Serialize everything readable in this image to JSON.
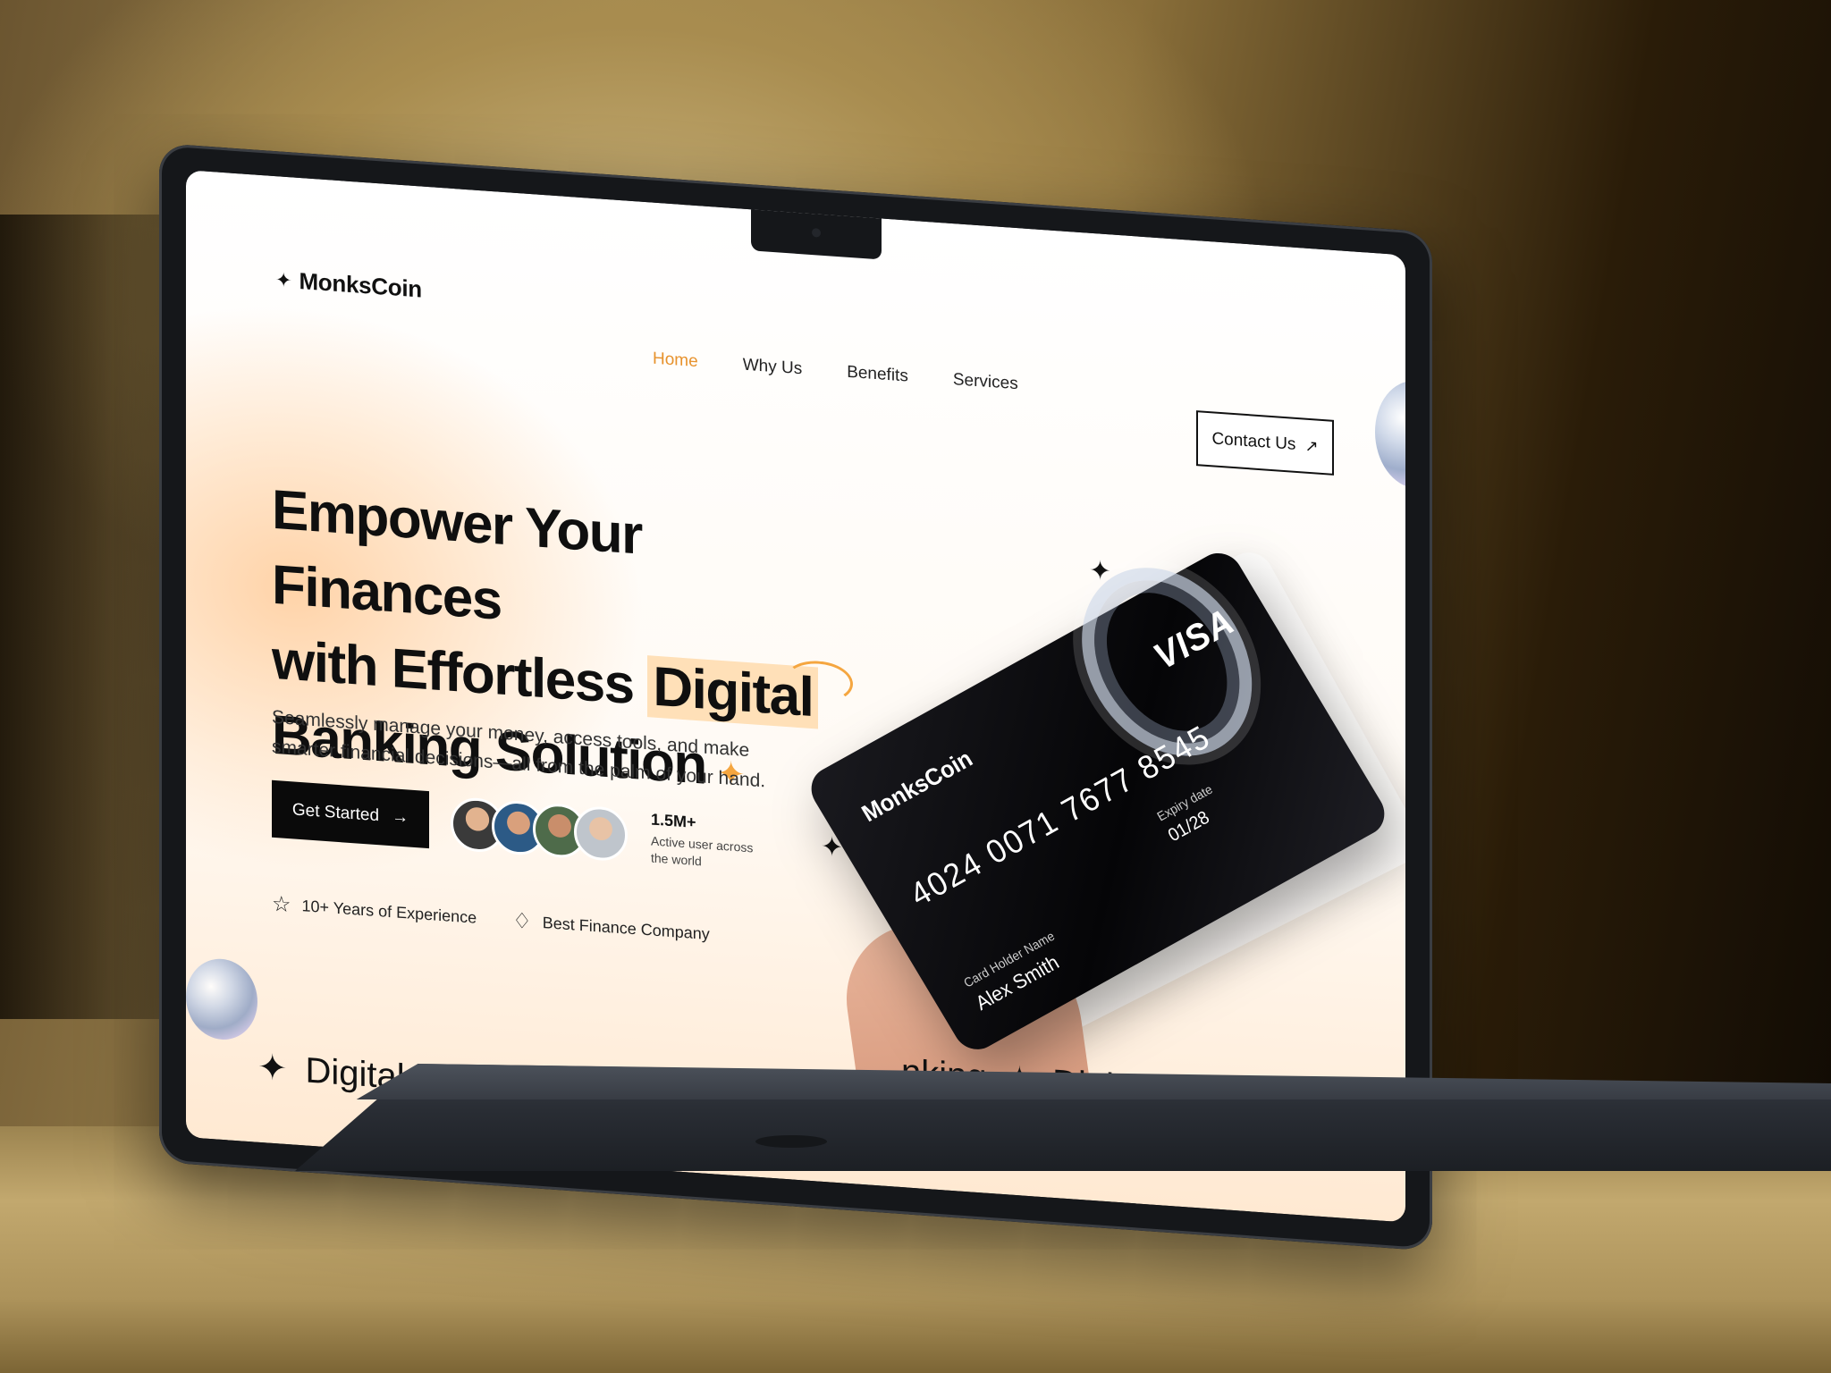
{
  "brand": {
    "name": "MonksCoin",
    "icon": "sparkle-icon"
  },
  "nav": {
    "items": [
      {
        "label": "Home",
        "active": true
      },
      {
        "label": "Why Us",
        "active": false
      },
      {
        "label": "Benefits",
        "active": false
      },
      {
        "label": "Services",
        "active": false
      }
    ]
  },
  "header": {
    "contact_label": "Contact Us",
    "contact_icon": "arrow-up-right-icon"
  },
  "hero": {
    "title_line1": "Empower Your Finances",
    "title_line2_a": "with Effortless ",
    "title_line2_highlight": "Digital",
    "title_line3": "Banking Solution",
    "subtitle": "Seamlessly manage your money, access tools, and make smarter financial decisions—all from the palm of your hand.",
    "cta_label": "Get Started",
    "stat_number": "1.5M+",
    "stat_desc": "Active user across the world",
    "badges": [
      {
        "icon": "star-icon",
        "label": "10+ Years of Experience"
      },
      {
        "icon": "diamond-icon",
        "label": "Best Finance Company"
      }
    ]
  },
  "card": {
    "brand": "MonksCoin",
    "network": "VISA",
    "number": "4024 0071 7677 8545",
    "expiry_label": "Expiry date",
    "expiry": "01/28",
    "holder_label": "Card Holder Name",
    "holder": "Alex Smith"
  },
  "ticker": {
    "left_text": "Digital",
    "right_text_a": "nking",
    "right_text_b": "Digital Ban"
  },
  "colors": {
    "accent": "#e7922c",
    "highlight": "#ffe0b8",
    "dark": "#0a0a0a"
  }
}
